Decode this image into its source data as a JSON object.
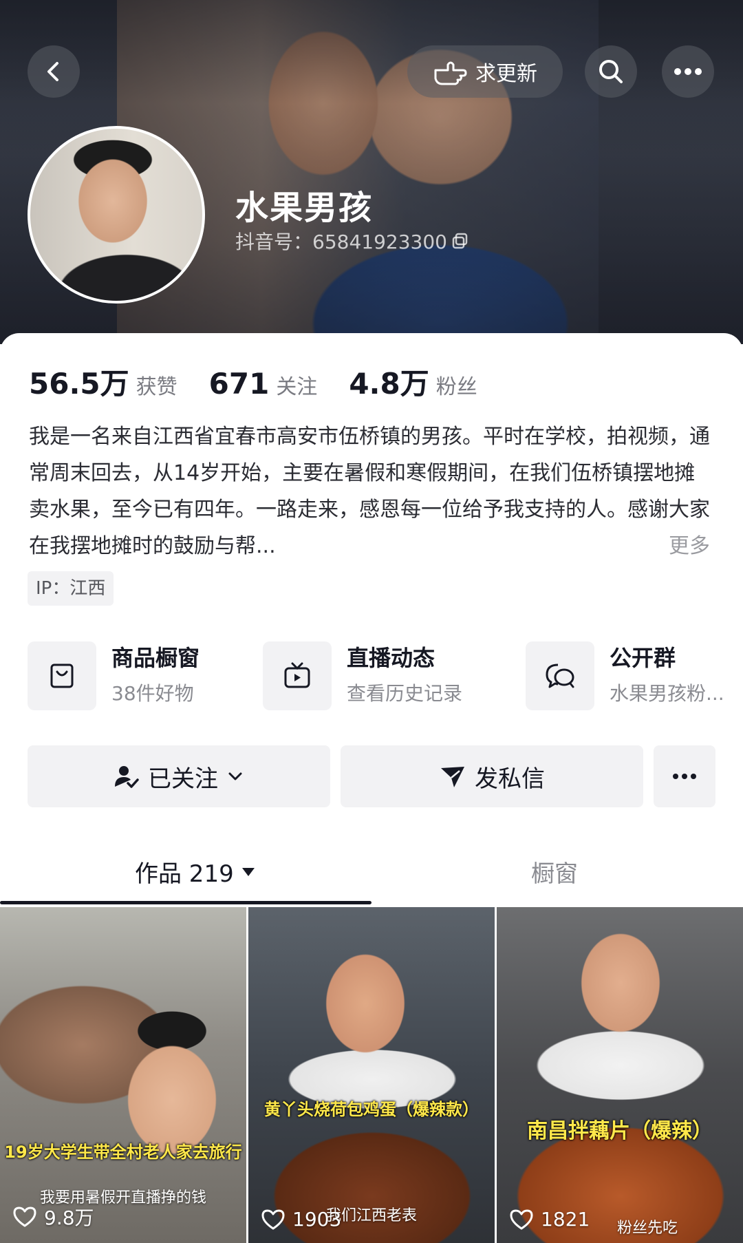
{
  "header": {
    "request_update_label": "求更新",
    "nickname": "水果男孩",
    "douyin_id": "抖音号：65841923300"
  },
  "stats": [
    {
      "value": "56.5万",
      "label": "获赞"
    },
    {
      "value": "671",
      "label": "关注"
    },
    {
      "value": "4.8万",
      "label": "粉丝"
    }
  ],
  "bio": {
    "text": "我是一名来自江西省宜春市高安市伍桥镇的男孩。平时在学校，拍视频，通常周末回去，从14岁开始，主要在暑假和寒假期间，在我们伍桥镇摆地摊卖水果，至今已有四年。一路走来，感恩每一位给予我支持的人。感谢大家在我摆地摊时的鼓励与帮...",
    "more_label": "更多"
  },
  "ip_label": "IP：江西",
  "entries": [
    {
      "icon": "shopping-bag-icon",
      "title": "商品橱窗",
      "sub": "38件好物"
    },
    {
      "icon": "tv-icon",
      "title": "直播动态",
      "sub": "查看历史记录"
    },
    {
      "icon": "chat-bubbles-icon",
      "title": "公开群",
      "sub": "水果男孩粉..."
    }
  ],
  "actions": {
    "follow_label": "已关注",
    "message_label": "发私信"
  },
  "tabs": [
    {
      "label": "作品 219"
    },
    {
      "label": "橱窗"
    }
  ],
  "videos": [
    {
      "caption": "19岁大学生带全村老人家去旅行",
      "sub": "我要用暑假开直播挣的钱",
      "likes": "9.8万"
    },
    {
      "caption": "黄丫头烧荷包鸡蛋（爆辣款）",
      "sub": "我们江西老表",
      "likes": "1903"
    },
    {
      "caption": "南昌拌藕片（爆辣）",
      "sub": "粉丝先吃",
      "likes": "1821"
    }
  ]
}
